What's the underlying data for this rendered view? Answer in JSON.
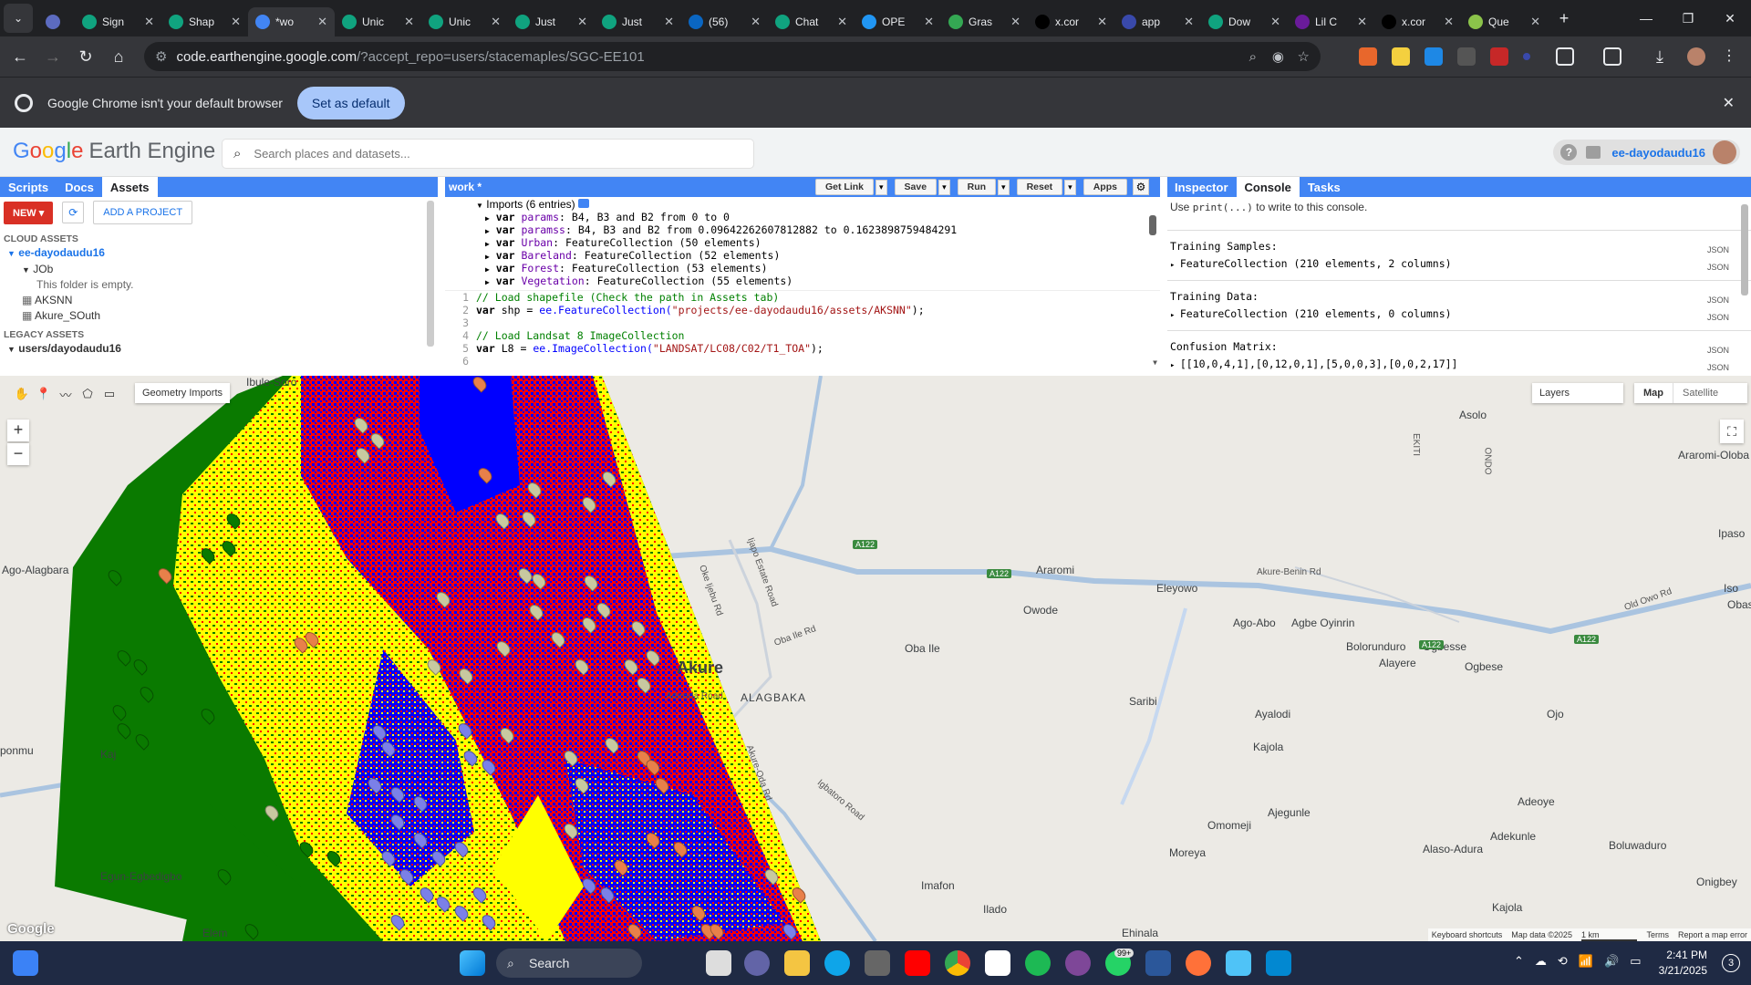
{
  "browser": {
    "tabs": [
      {
        "label": "",
        "icon": "gem-icon"
      },
      {
        "label": "Sign",
        "icon": "openai-icon"
      },
      {
        "label": "Shap",
        "icon": "openai-icon"
      },
      {
        "label": "*wo",
        "icon": "earthengine-icon",
        "active": true
      },
      {
        "label": "Unic",
        "icon": "openai-icon"
      },
      {
        "label": "Unic",
        "icon": "openai-icon"
      },
      {
        "label": "Just",
        "icon": "openai-icon"
      },
      {
        "label": "Just",
        "icon": "openai-icon"
      },
      {
        "label": "(56)",
        "icon": "linkedin-icon"
      },
      {
        "label": "Chat",
        "icon": "openai-icon"
      },
      {
        "label": "OPE",
        "icon": "globe-icon"
      },
      {
        "label": "Gras",
        "icon": "chart-icon"
      },
      {
        "label": "x.cor",
        "icon": "x-icon"
      },
      {
        "label": "app",
        "icon": "page-icon"
      },
      {
        "label": "Dow",
        "icon": "openai-icon"
      },
      {
        "label": "Lil C",
        "icon": "music-icon"
      },
      {
        "label": "x.cor",
        "icon": "x-icon"
      },
      {
        "label": "Que",
        "icon": "leaf-icon"
      }
    ],
    "url_host": "code.earthengine.google.com",
    "url_path": "/?accept_repo=users/stacemaples/SGC-EE101",
    "infobar_text": "Google Chrome isn't your default browser",
    "infobar_button": "Set as default"
  },
  "gee": {
    "logo_google": [
      "G",
      "o",
      "o",
      "g",
      "l",
      "e"
    ],
    "logo_rest": "Earth Engine",
    "search_placeholder": "Search places and datasets...",
    "user": "ee-dayodaudu16",
    "left_tabs": [
      "Scripts",
      "Docs",
      "Assets"
    ],
    "left_active": "Assets",
    "new_button": "NEW",
    "add_project": "ADD A PROJECT",
    "cloud_assets": "CLOUD ASSETS",
    "project": "ee-dayodaudu16",
    "folder": "JOb",
    "folder_empty": "This folder is empty.",
    "assets": [
      "AKSNN",
      "Akure_SOuth"
    ],
    "legacy_assets": "LEGACY ASSETS",
    "legacy_user": "users/dayodaudu16",
    "script_name": "work *",
    "editor_buttons": [
      "Get Link",
      "Save",
      "Run",
      "Reset",
      "Apps"
    ],
    "imports_header": "Imports (6 entries)",
    "imports": [
      {
        "name": "params",
        "value": "B4, B3 and B2 from 0 to 0"
      },
      {
        "name": "paramss",
        "value": "B4, B3 and B2 from 0.09642262607812882 to 0.1623898759484291"
      },
      {
        "name": "Urban",
        "value": "FeatureCollection (50 elements)"
      },
      {
        "name": "Bareland",
        "value": "FeatureCollection (52 elements)"
      },
      {
        "name": "Forest",
        "value": "FeatureCollection (53 elements)"
      },
      {
        "name": "Vegetation",
        "value": "FeatureCollection (55 elements)"
      }
    ],
    "code": [
      {
        "n": "1",
        "comment": "// Load shapefile (Check the path in Assets tab)"
      },
      {
        "n": "2",
        "var": "shp",
        "call": "ee.FeatureCollection(",
        "str": "\"projects/ee-dayodaudu16/assets/AKSNN\"",
        "end": ");"
      },
      {
        "n": "3"
      },
      {
        "n": "4",
        "comment": "// Load Landsat 8 ImageCollection"
      },
      {
        "n": "5",
        "var": "L8",
        "call": "ee.ImageCollection(",
        "str": "\"LANDSAT/LC08/C02/T1_TOA\"",
        "end": ");"
      },
      {
        "n": "6"
      }
    ],
    "right_tabs": [
      "Inspector",
      "Console",
      "Tasks"
    ],
    "right_active": "Console",
    "console_hint_pre": "Use ",
    "console_hint_code": "print(...)",
    "console_hint_post": " to write to this console.",
    "console_entries": [
      {
        "label": "Training Samples:",
        "value": "FeatureCollection (210 elements, 2 columns)"
      },
      {
        "label": "Training Data:",
        "value": "FeatureCollection (210 elements, 0 columns)"
      },
      {
        "label": "Confusion Matrix:",
        "value": "[[10,0,4,1],[0,12,0,1],[5,0,0,3],[0,0,2,17]]"
      }
    ],
    "json_label": "JSON"
  },
  "map": {
    "geometry_imports": "Geometry Imports",
    "layers": "Layers",
    "map_btn": "Map",
    "satellite_btn": "Satellite",
    "zoom_in": "+",
    "zoom_out": "−",
    "places": [
      "Ibule-Soro",
      "Asolo",
      "Araromi-Oloba",
      "Ago-Alagbara",
      "Araromi",
      "Ipaso",
      "Eleyowo",
      "Owode",
      "Ago-Abo",
      "Agbe Oyinrin",
      "Iso",
      "Obase",
      "Oba Ile",
      "Bolorunduro",
      "Ogbesse",
      "Alayere",
      "Ogbese",
      "Akure",
      "ALAGBAKA",
      "Saribi",
      "Ayalodi",
      "Ojo",
      "Kajola",
      "ponmu",
      "Kaj",
      "Adeoye",
      "Ajegunle",
      "Omomeji",
      "Adekunle",
      "Boluwaduro",
      "Moreya",
      "Alaso-Adura",
      "Egun-Egbedigbo",
      "Imafon",
      "Onigbey",
      "Ilado",
      "Kajola",
      "Elem",
      "Ehinala",
      "ONDO",
      "EKITI"
    ],
    "roads": [
      "A122",
      "A122",
      "A122",
      "A122",
      "Akure-Benin Rd",
      "Old Owo Rd",
      "Oke Ijebu Rd",
      "Ijapo Estate Road",
      "Oba Ile Rd",
      "Adesida Road",
      "Akure-Oda Rd",
      "Igbatoro Road"
    ],
    "footer": [
      "Keyboard shortcuts",
      "Map data ©2025",
      "1 km",
      "Terms",
      "Report a map error"
    ],
    "google": "Google"
  },
  "taskbar": {
    "search": "Search",
    "time": "2:41 PM",
    "date": "3/21/2025",
    "badge": "99+",
    "notif": "3"
  },
  "colors": {
    "tabstrip": "#202124",
    "gee_blue": "#4285f4",
    "forest": "#0a7a00",
    "bareland": "#ffff00",
    "urban": "#ff0000",
    "vegetation": "#0000ff"
  }
}
